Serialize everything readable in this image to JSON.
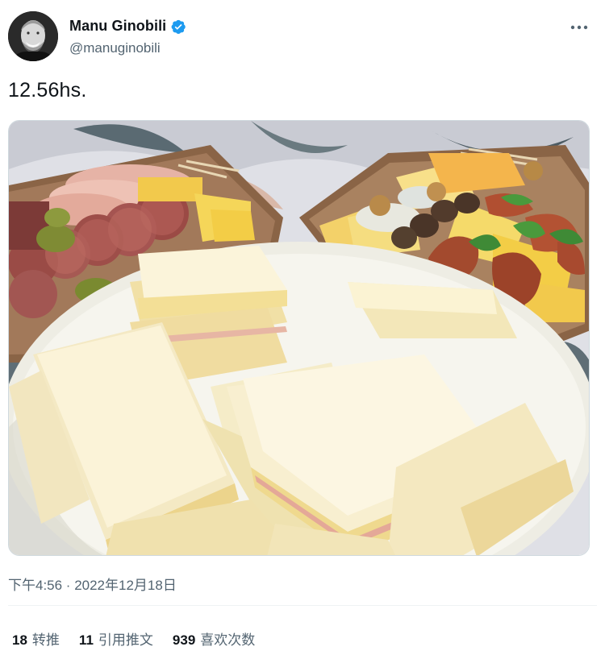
{
  "author": {
    "display_name": "Manu Ginobili",
    "handle": "@manuginobili",
    "verified_icon": "verified-badge-icon",
    "verified_color": "#1d9bf0"
  },
  "more_icon": "more-horizontal-icon",
  "tweet": {
    "text": "12.56hs."
  },
  "timestamp": "下午4:56 · 2022年12月18日",
  "stats": {
    "retweets": {
      "count": "18",
      "label": "转推"
    },
    "quotes": {
      "count": "11",
      "label": "引用推文"
    },
    "likes": {
      "count": "939",
      "label": "喜欢次数"
    }
  },
  "colors": {
    "text_primary": "#0f1419",
    "text_secondary": "#536471",
    "divider": "#eff3f4"
  }
}
